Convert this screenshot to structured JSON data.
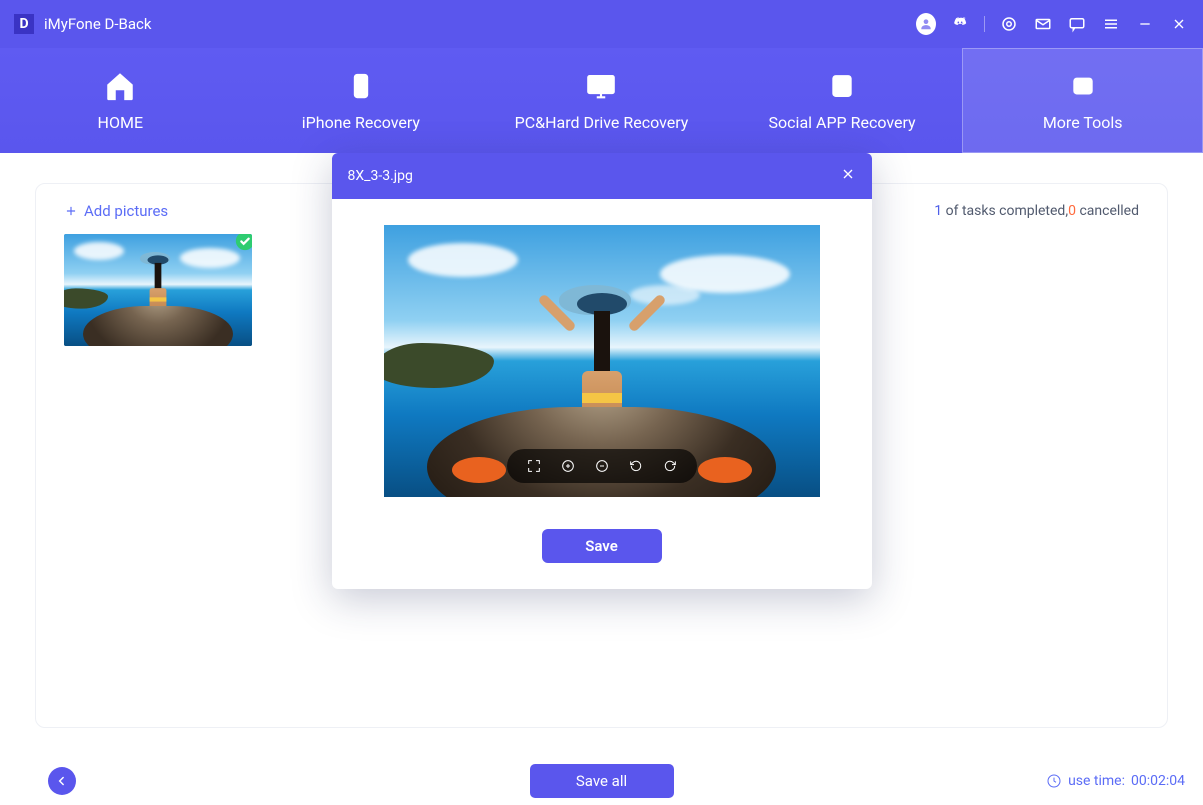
{
  "app": {
    "logo_letter": "D",
    "title": "iMyFone D-Back"
  },
  "nav": {
    "items": [
      {
        "label": "HOME"
      },
      {
        "label": "iPhone Recovery"
      },
      {
        "label": "PC&Hard Drive Recovery"
      },
      {
        "label": "Social APP Recovery"
      },
      {
        "label": "More Tools"
      }
    ]
  },
  "card": {
    "add_label": "Add pictures",
    "tasks": {
      "completed": "1",
      "completed_suffix": " of tasks completed,",
      "cancelled": "0",
      "cancelled_suffix": " cancelled"
    }
  },
  "modal": {
    "filename": "8X_3-3.jpg",
    "save_label": "Save"
  },
  "footer": {
    "save_all": "Save all",
    "use_time_label": "use time:",
    "use_time_value": "00:02:04"
  }
}
